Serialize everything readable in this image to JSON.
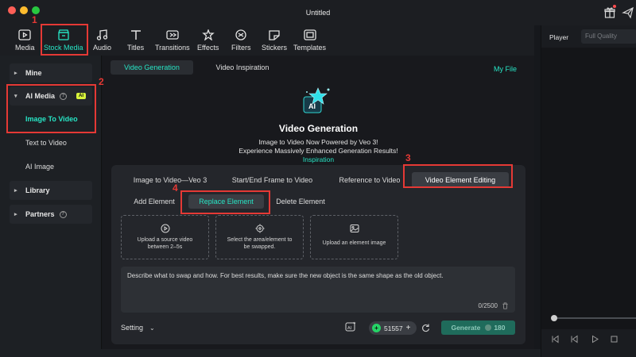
{
  "window": {
    "title": "Untitled"
  },
  "toolbar": {
    "items": [
      {
        "label": "Media",
        "icon": "media-icon"
      },
      {
        "label": "Stock Media",
        "icon": "stock-media-icon"
      },
      {
        "label": "Audio",
        "icon": "audio-icon"
      },
      {
        "label": "Titles",
        "icon": "titles-icon"
      },
      {
        "label": "Transitions",
        "icon": "transitions-icon"
      },
      {
        "label": "Effects",
        "icon": "effects-icon"
      },
      {
        "label": "Filters",
        "icon": "filters-icon"
      },
      {
        "label": "Stickers",
        "icon": "stickers-icon"
      },
      {
        "label": "Templates",
        "icon": "templates-icon"
      }
    ],
    "active": "Stock Media"
  },
  "sidebar": {
    "mine": "Mine",
    "ai_media": "AI Media",
    "ai_badge": "AI",
    "image_to_video": "Image To Video",
    "text_to_video": "Text to Video",
    "ai_image": "AI Image",
    "library": "Library",
    "partners": "Partners"
  },
  "main": {
    "tabs": [
      "Video Generation",
      "Video Inspiration"
    ],
    "active_tab": "Video Generation",
    "my_file": "My File",
    "hero": {
      "icon_text": "AI",
      "title": "Video Generation",
      "line1": "Image to Video Now Powered by Veo 3!",
      "line2": "Experience Massively Enhanced Generation Results!",
      "link": "Inspiration"
    },
    "mode_tabs": [
      "Image to Video—Veo 3",
      "Start/End Frame to Video",
      "Reference to Video",
      "Video Element Editing"
    ],
    "active_mode": "Video Element Editing",
    "sub_tabs": [
      "Add Element",
      "Replace Element",
      "Delete Element"
    ],
    "active_sub": "Replace Element",
    "slots": [
      "Upload a source video between 2–5s",
      "Select the area/element to be swapped.",
      "Upload an element image"
    ],
    "prompt": "Describe what to swap and how. For best results, make sure the new object is the same shape as the old object.",
    "char_count": "0/2500",
    "setting_label": "Setting",
    "credits": "51557",
    "generate_label": "Generate",
    "generate_cost": "180"
  },
  "player": {
    "label": "Player",
    "quality": "Full Quality"
  },
  "annotations": [
    "1",
    "2",
    "3",
    "4"
  ],
  "colors": {
    "accent": "#27e5c5",
    "annotation": "#e53935",
    "ai_badge": "#d7f33b"
  }
}
